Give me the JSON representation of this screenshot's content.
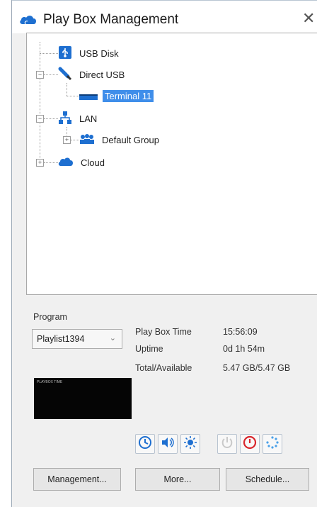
{
  "window": {
    "title": "Play Box Management",
    "close_symbol": "✕"
  },
  "tree": {
    "usb_disk": "USB Disk",
    "direct_usb": "Direct USB",
    "terminal": "Terminal 11",
    "lan": "LAN",
    "default_group": "Default Group",
    "cloud": "Cloud",
    "expand_symbol": "+",
    "collapse_symbol": "−"
  },
  "program": {
    "label": "Program",
    "selected": "Playlist1394",
    "preview_text": "PLAYBOX TIME"
  },
  "info": {
    "play_box_time_label": "Play Box Time",
    "play_box_time_value": "15:56:09",
    "uptime_label": "Uptime",
    "uptime_value": "0d 1h 54m",
    "storage_label": "Total/Available",
    "storage_value": "5.47 GB/5.47 GB"
  },
  "icons": [
    "clock-icon",
    "speaker-icon",
    "brightness-icon",
    "power-icon",
    "shutdown-icon",
    "loading-icon"
  ],
  "buttons": {
    "management": "Management...",
    "more": "More...",
    "schedule": "Schedule..."
  },
  "colors": {
    "selection": "#3f8eea",
    "accent_blue": "#1e6fd0",
    "red": "#d9262c"
  }
}
